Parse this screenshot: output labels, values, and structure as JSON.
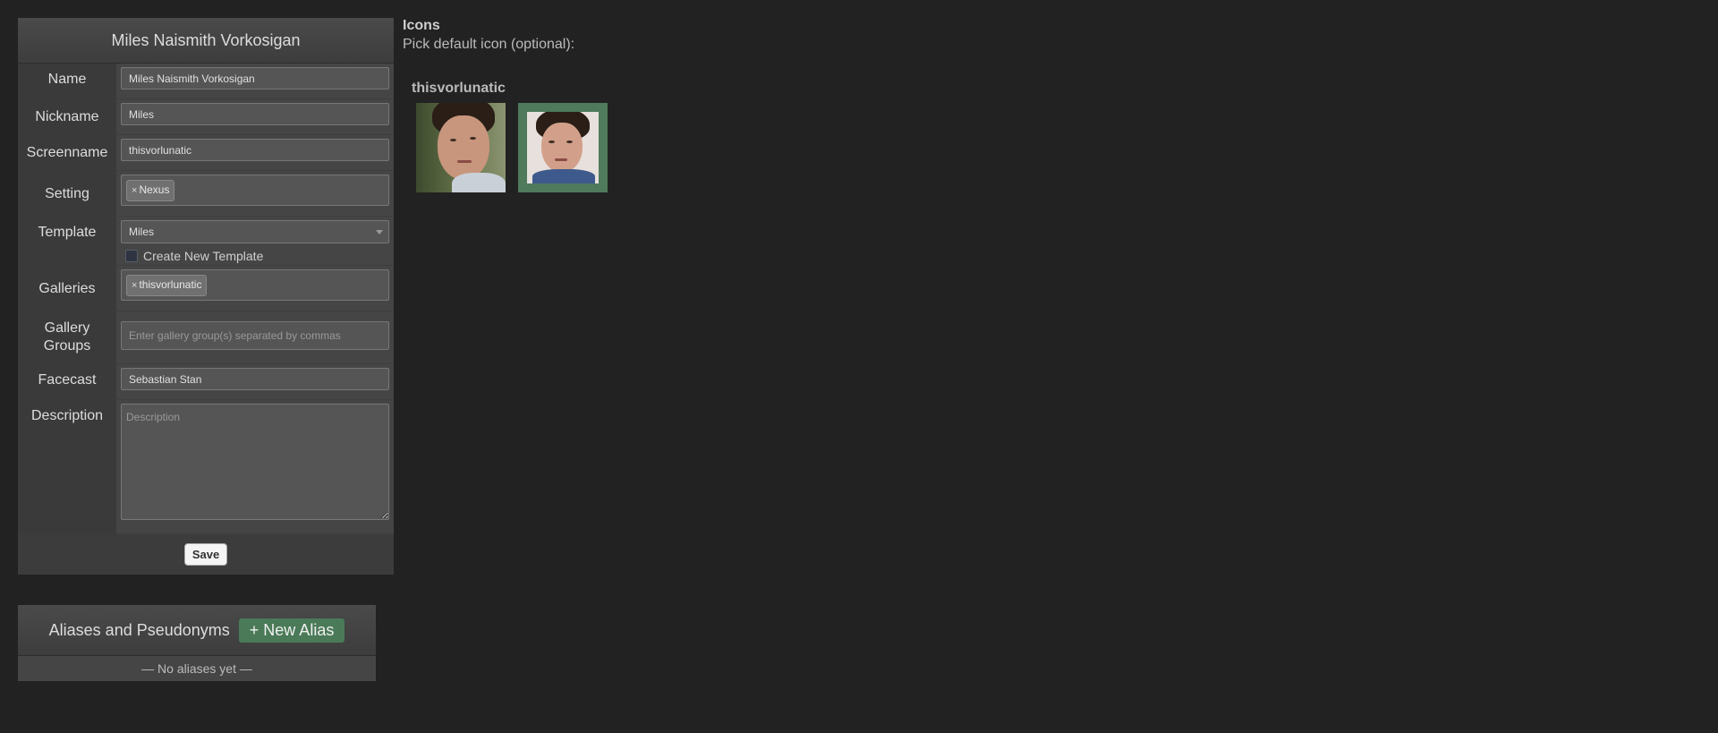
{
  "character": {
    "title": "Miles Naismith Vorkosigan",
    "fields": {
      "name_label": "Name",
      "name_value": "Miles Naismith Vorkosigan",
      "nickname_label": "Nickname",
      "nickname_value": "Miles",
      "screenname_label": "Screenname",
      "screenname_value": "thisvorlunatic",
      "setting_label": "Setting",
      "setting_tag": "Nexus",
      "template_label": "Template",
      "template_value": "Miles",
      "create_template_label": "Create New Template",
      "galleries_label": "Galleries",
      "galleries_tag": "thisvorlunatic",
      "gallery_groups_label_1": "Gallery",
      "gallery_groups_label_2": "Groups",
      "gallery_groups_placeholder": "Enter gallery group(s) separated by commas",
      "facecast_label": "Facecast",
      "facecast_value": "Sebastian Stan",
      "description_label": "Description",
      "description_placeholder": "Description"
    },
    "tag_remove_glyph": "×",
    "save_label": "Save"
  },
  "aliases": {
    "title": "Aliases and Pseudonyms",
    "new_alias_label": "+ New Alias",
    "empty_text": "— No aliases yet —"
  },
  "icons": {
    "heading": "Icons",
    "subheading": "Pick default icon (optional):",
    "gallery_name": "thisvorlunatic",
    "selected_index": 1,
    "accent_color": "#4f7a5c"
  },
  "colors": {
    "background": "#222222",
    "panel": "#3a3a3a",
    "new_alias_button": "#4a7a58"
  }
}
